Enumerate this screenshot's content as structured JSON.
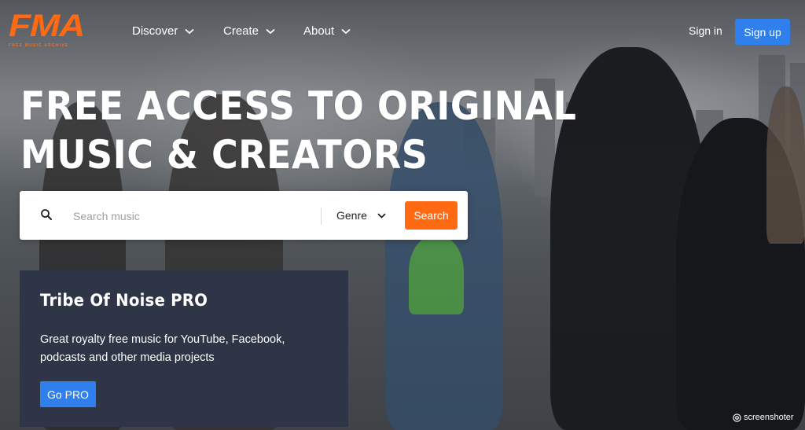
{
  "brand": {
    "logo_text": "FMA",
    "tagline": "FREE MUSIC ARCHIVE",
    "accent_color": "#ff6a13",
    "button_color": "#2f80ed"
  },
  "nav": {
    "items": [
      {
        "label": "Discover",
        "icon": "chevron-down-icon"
      },
      {
        "label": "Create",
        "icon": "chevron-down-icon"
      },
      {
        "label": "About",
        "icon": "chevron-down-icon"
      }
    ],
    "sign_in": "Sign in",
    "sign_up": "Sign up"
  },
  "hero": {
    "headline_line1": "FREE ACCESS TO ORIGINAL",
    "headline_line2": "MUSIC & CREATORS"
  },
  "search": {
    "icon": "search-icon",
    "placeholder": "Search music",
    "genre_label": "Genre",
    "button_label": "Search"
  },
  "pro_card": {
    "title": "Tribe Of Noise PRO",
    "description": "Great royalty free music for YouTube, Facebook, podcasts and other media projects",
    "button_label": "Go PRO"
  },
  "watermark": "screenshoter"
}
